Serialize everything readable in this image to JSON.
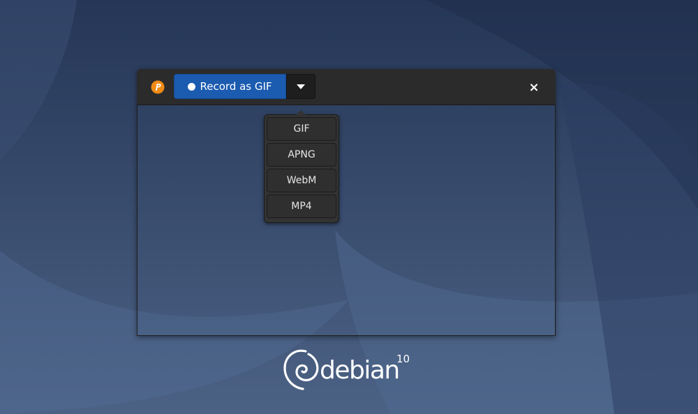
{
  "window": {
    "record_label": "Record as GIF",
    "close_glyph": "×",
    "app_icon": "peek-logo-icon",
    "dropdown_icon": "triangle-down-icon"
  },
  "format_menu": {
    "options": [
      "GIF",
      "APNG",
      "WebM",
      "MP4"
    ]
  },
  "branding": {
    "name": "debian",
    "version": "10"
  },
  "colors": {
    "accent": "#1b5bb0",
    "headerbar": "#2b2b2b",
    "wallpaper": "#2e4163",
    "app_icon": "#f08a16"
  }
}
